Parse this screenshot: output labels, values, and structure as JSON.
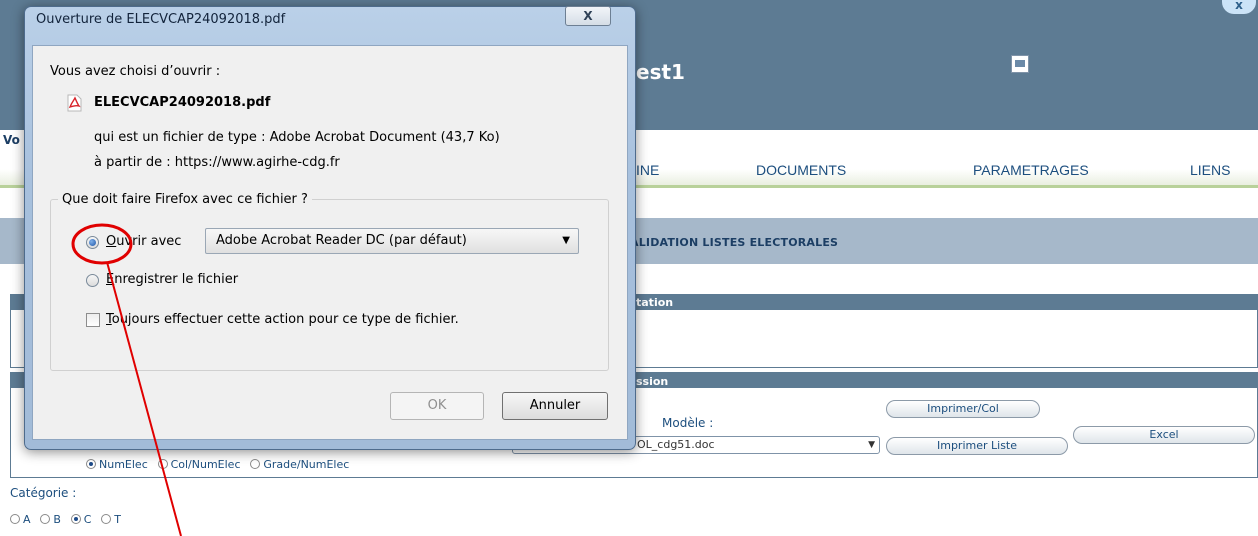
{
  "app": {
    "title_fragment": "est1",
    "close_glyph": "x",
    "user_fragment": "Vo",
    "nav": {
      "item1_fragment": "INE",
      "documents": "DOCUMENTS",
      "parametrages": "PARAMETRAGES",
      "liens": "LIENS"
    },
    "section_title": "ALIDATION LISTES ELECTORALES",
    "panel1_label": "tation",
    "panel2_label": "ssion",
    "modele_label": "Modèle :",
    "modele_value": "OL_cdg51.doc",
    "buttons": {
      "imprimer_col": "Imprimer/Col",
      "imprimer_liste": "Imprimer Liste",
      "excel": "Excel"
    },
    "sort_options": [
      "NumElec",
      "Col/NumElec",
      "Grade/NumElec"
    ],
    "sort_selected_index": 0,
    "categorie_label": "Catégorie :",
    "categories": [
      "A",
      "B",
      "C",
      "T"
    ],
    "category_selected_index": 2
  },
  "dialog": {
    "title": "Ouverture de ELECVCAP24092018.pdf",
    "close_glyph": "X",
    "intro": "Vous avez choisi d’ouvrir :",
    "filename": "ELECVCAP24092018.pdf",
    "type_line": "qui est un fichier de type : Adobe Acrobat Document (43,7 Ko)",
    "from_line": "à partir de : https://www.agirhe-cdg.fr",
    "question": "Que doit faire Firefox avec ce fichier ?",
    "open_with_label": "Ouvrir avec",
    "open_with_selected": true,
    "open_with_app": "Adobe Acrobat Reader DC  (par défaut)",
    "save_label": "Enregistrer le fichier",
    "save_selected": false,
    "always_label": "Toujours effectuer cette action pour ce type de fichier.",
    "always_checked": false,
    "ok_label": "OK",
    "cancel_label": "Annuler"
  },
  "annotation": {
    "color": "#e00000"
  }
}
